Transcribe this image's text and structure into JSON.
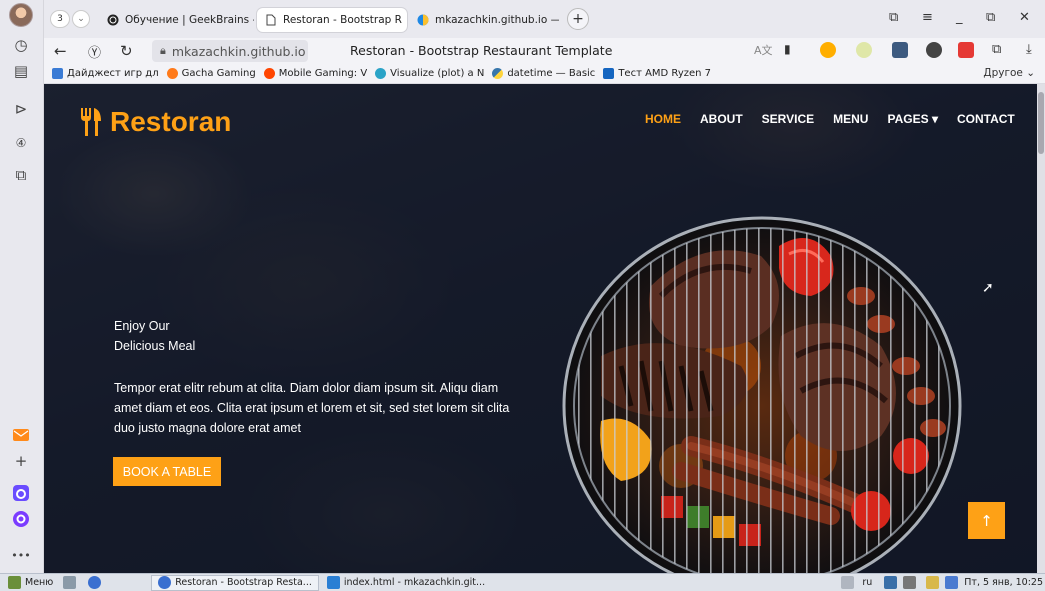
{
  "browser": {
    "tab_count": "3",
    "tabs": [
      {
        "label": "Обучение | GeekBrains -"
      },
      {
        "label": "Restoran - Bootstrap R",
        "close": "×"
      },
      {
        "label": "mkazachkin.github.io — ∃"
      }
    ],
    "new_tab": "+",
    "url": "mkazachkin.github.io",
    "page_title": "Restoran - Bootstrap Restaurant Template",
    "bookmarks": [
      {
        "label": "Дайджест игр дл"
      },
      {
        "label": "Gacha Gaming"
      },
      {
        "label": "Mobile Gaming: V"
      },
      {
        "label": "Visualize (plot) a N"
      },
      {
        "label": "datetime — Basic"
      },
      {
        "label": "Тест AMD Ryzen 7"
      }
    ],
    "bookmarks_other": "Другое ⌄"
  },
  "site": {
    "brand": "Restoran",
    "nav": [
      {
        "label": "HOME",
        "active": true
      },
      {
        "label": "ABOUT"
      },
      {
        "label": "SERVICE"
      },
      {
        "label": "MENU"
      },
      {
        "label": "PAGES ▾"
      },
      {
        "label": "CONTACT"
      }
    ],
    "hero": {
      "line1": "Enjoy Our",
      "line2": "Delicious Meal",
      "text": "Tempor erat elitr rebum at clita. Diam dolor diam ipsum sit. Aliqu diam amet diam et eos. Clita erat ipsum et lorem et sit, sed stet lorem sit clita duo justo magna dolore erat amet",
      "button": "BOOK A TABLE"
    },
    "back_to_top": "↑"
  },
  "taskbar": {
    "menu": "Меню",
    "windows": [
      {
        "label": "Restoran - Bootstrap Resta..."
      },
      {
        "label": "index.html - mkazachkin.git..."
      }
    ],
    "lang": "ru",
    "clock": "Пт, 5 янв, 10:25"
  },
  "colors": {
    "accent": "#fea116",
    "hero_overlay": "#0f172b"
  }
}
